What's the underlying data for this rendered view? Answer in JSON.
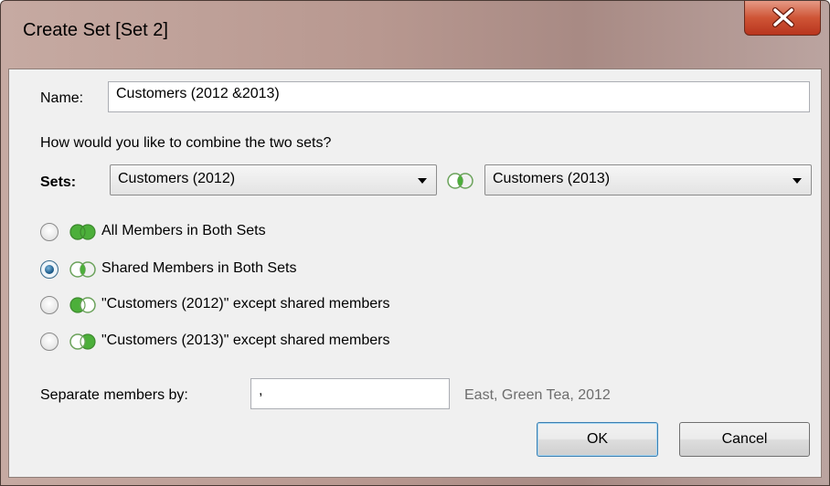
{
  "window": {
    "title": "Create Set [Set 2]",
    "close_icon": "close-icon"
  },
  "name_field": {
    "label": "Name:",
    "value": "Customers (2012 &2013)"
  },
  "combine_prompt": "How would you like to combine the two sets?",
  "sets": {
    "label": "Sets:",
    "left_selected": "Customers (2012)",
    "right_selected": "Customers (2013)",
    "operator_icon": "venn-intersect-icon"
  },
  "options": [
    {
      "label": "All Members in Both Sets",
      "checked": false,
      "icon": "venn-union-icon"
    },
    {
      "label": "Shared Members in Both Sets",
      "checked": true,
      "icon": "venn-intersect-icon"
    },
    {
      "label": "\"Customers (2012)\" except shared members",
      "checked": false,
      "icon": "venn-left-only-icon"
    },
    {
      "label": "\"Customers (2013)\" except shared members",
      "checked": false,
      "icon": "venn-right-only-icon"
    }
  ],
  "separator": {
    "label": "Separate members by:",
    "value": ",",
    "example": "East, Green Tea, 2012"
  },
  "buttons": {
    "ok": "OK",
    "cancel": "Cancel"
  },
  "colors": {
    "venn_green": "#4caf3a",
    "radio_selected": "#1f5f8f",
    "close_button": "#c7442a"
  }
}
